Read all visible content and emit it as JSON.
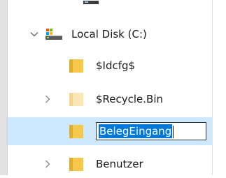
{
  "tree": {
    "drive_label": "Local Disk (C:)",
    "items": [
      {
        "label": "$Idcfg$",
        "has_children": false
      },
      {
        "label": "$Recycle.Bin",
        "has_children": true
      },
      {
        "label": "BelegEingang",
        "has_children": false,
        "selected": true,
        "renaming": true
      },
      {
        "label": "Benutzer",
        "has_children": true
      }
    ]
  },
  "colors": {
    "selection_background": "#cde8ff",
    "text_selection": "#0078d7",
    "folder_yellow": "#f5c84c"
  }
}
